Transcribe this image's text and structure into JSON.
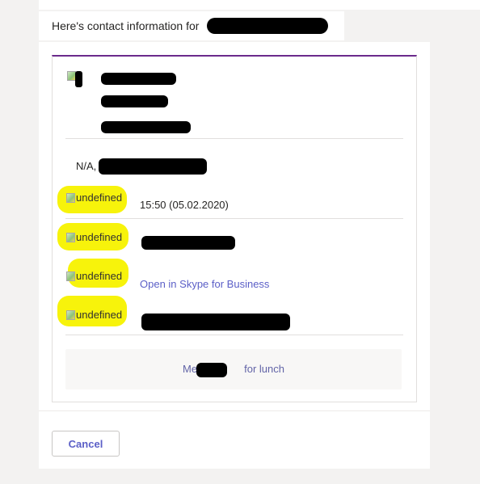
{
  "intro": {
    "text": "Here's contact information for"
  },
  "card": {
    "field_prefix": "N/A,",
    "rows": [
      {
        "icon_alt": "undefined",
        "value": "15:50 (05.02.2020)"
      },
      {
        "icon_alt": "undefined",
        "value": ""
      },
      {
        "icon_alt": "undefined",
        "value": "Open in Skype for Business"
      },
      {
        "icon_alt": "undefined",
        "value": ""
      }
    ],
    "action": {
      "prefix": "Meet",
      "suffix": "for lunch"
    }
  },
  "footer": {
    "cancel_label": "Cancel"
  },
  "colors": {
    "accent": "#6b2a8c",
    "link": "#5b5fc7",
    "highlight": "#f7f30b",
    "redaction": "#000000"
  },
  "icons": [
    "broken-image-icon"
  ]
}
